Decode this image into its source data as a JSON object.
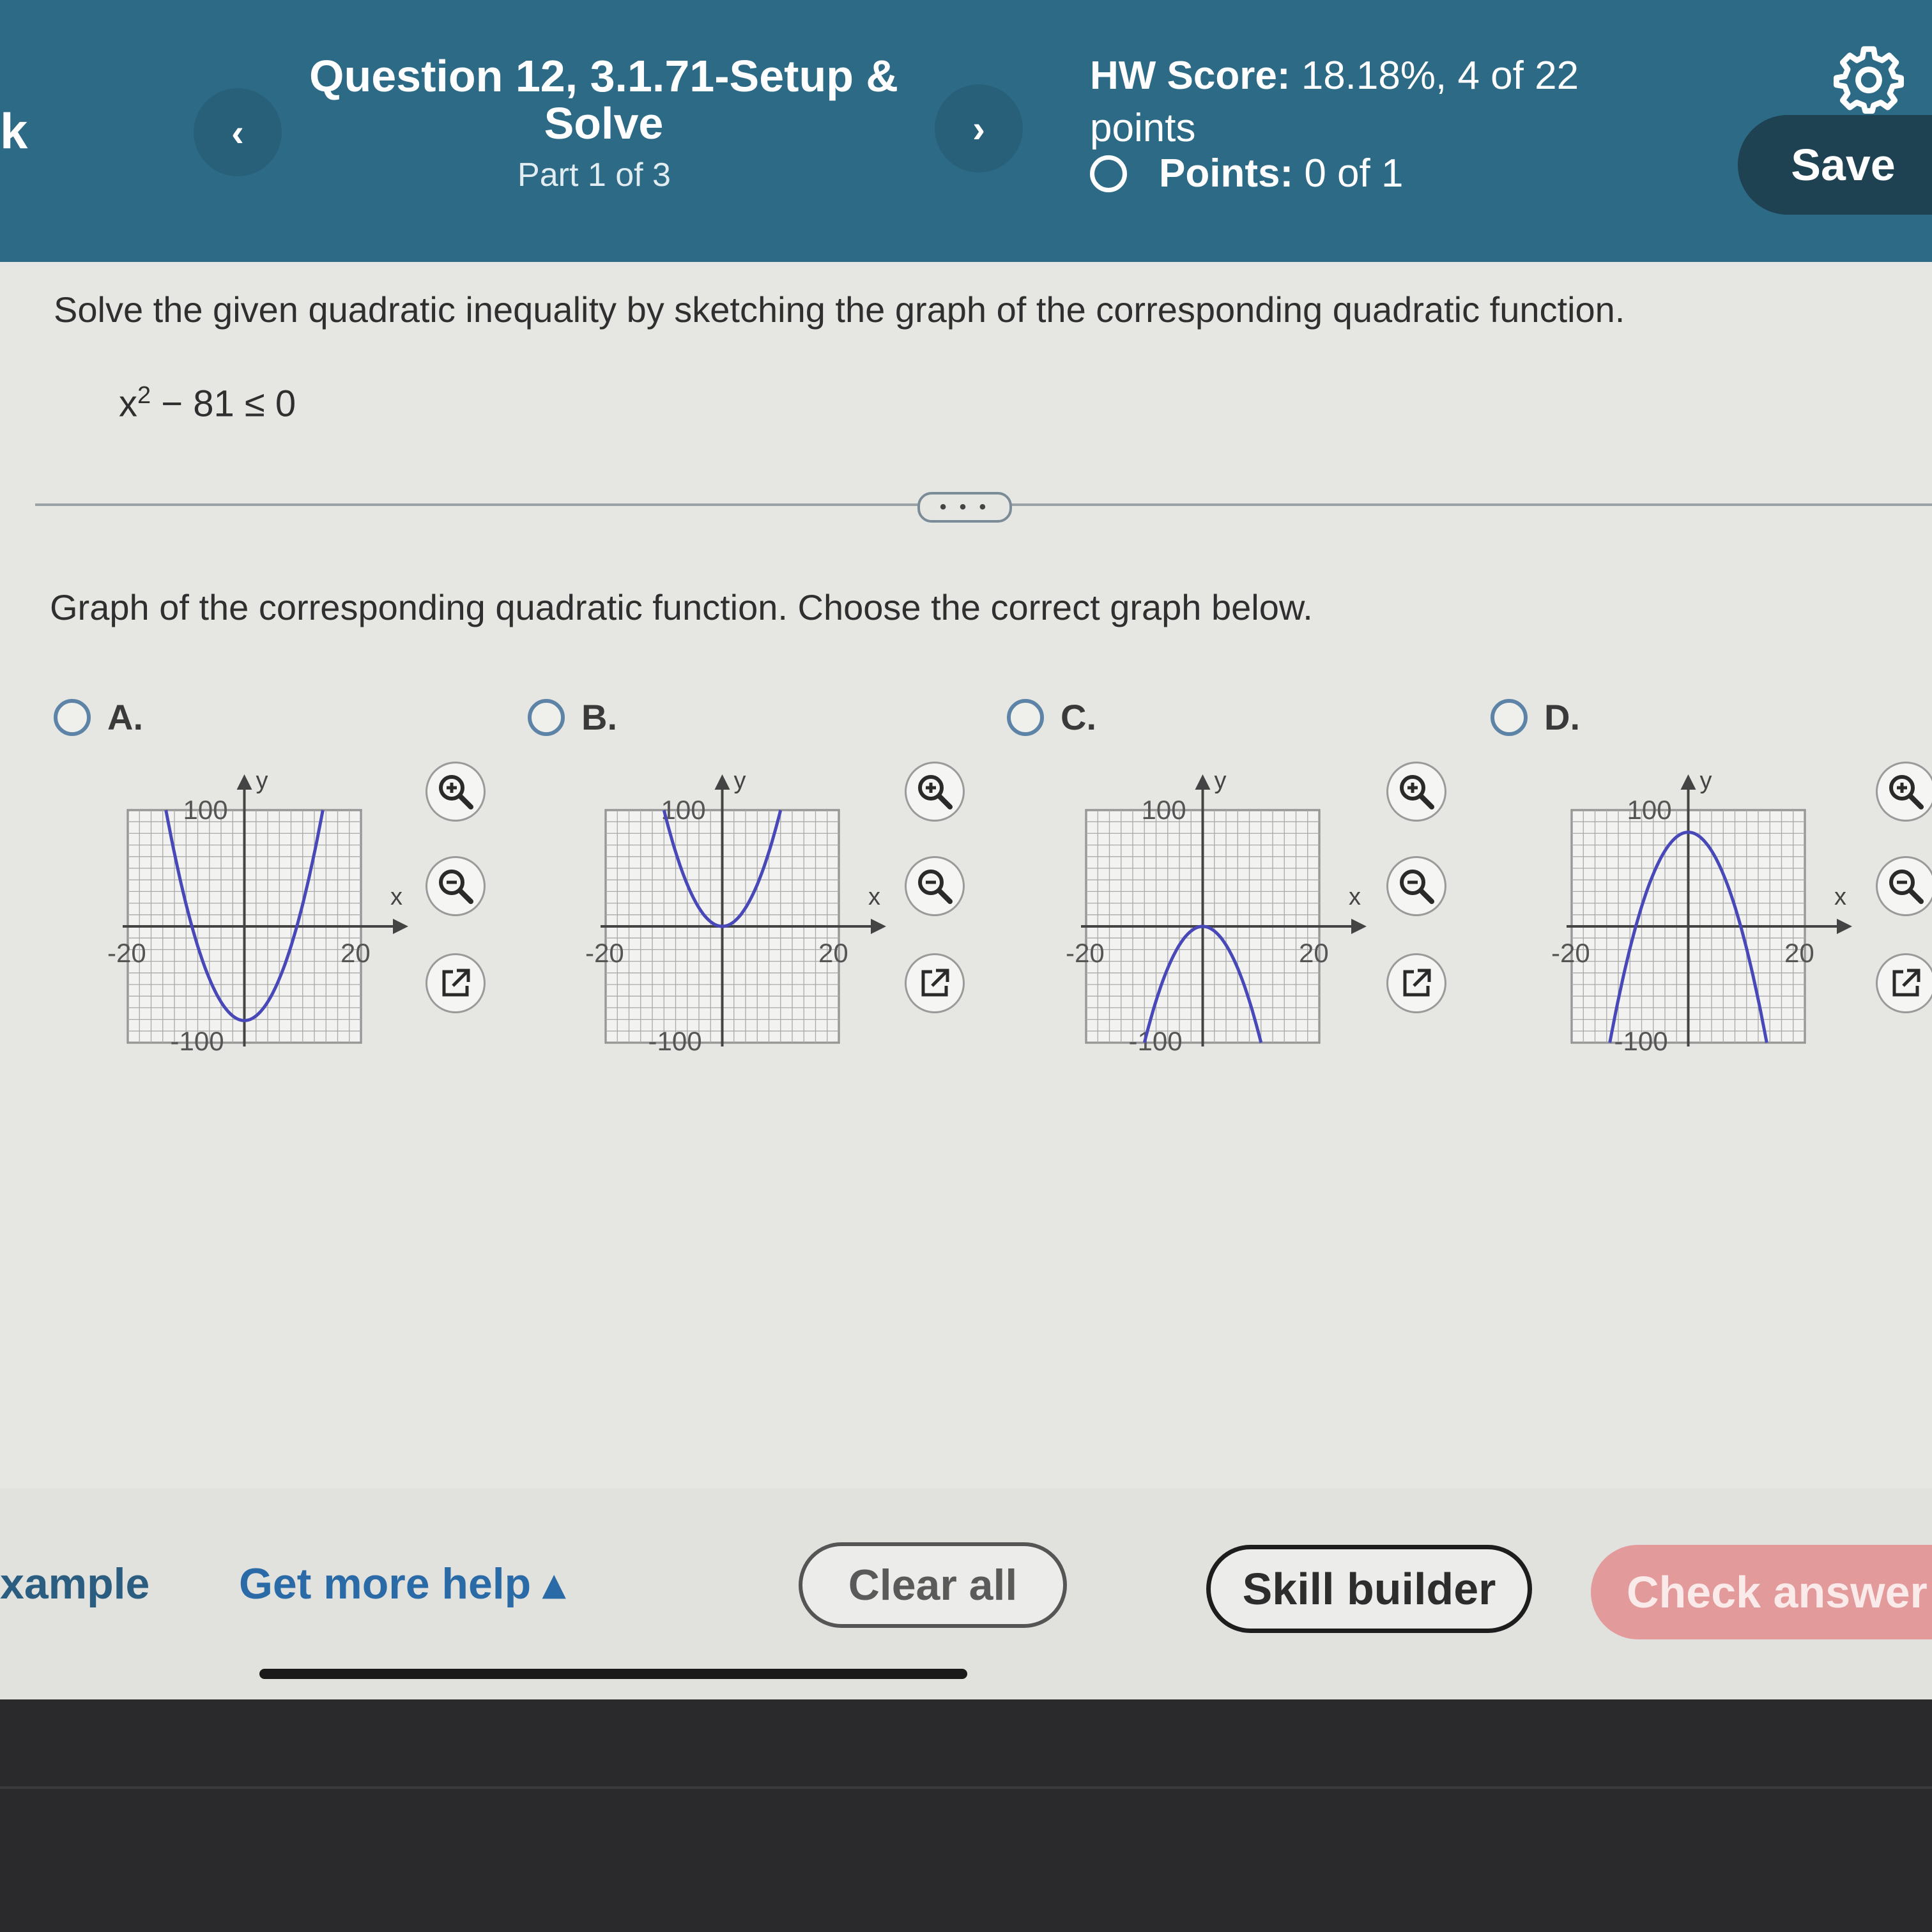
{
  "header": {
    "left_edge_text": "k",
    "question_title": "Question 12, 3.1.71-Setup & Solve",
    "part": "Part 1 of 3",
    "hw_score_label": "HW Score:",
    "hw_score_value": "18.18%, 4 of 22 points",
    "points_label": "Points:",
    "points_value": "0 of 1",
    "prev_icon": "‹",
    "next_icon": "›",
    "save_label": "Save"
  },
  "question": {
    "instruction": "Solve the given quadratic inequality by sketching the graph of the corresponding quadratic function.",
    "inequality_base": "x",
    "inequality_exp": "2",
    "inequality_rest": " − 81 ≤ 0",
    "expand_label": "• • •",
    "prompt": "Graph of the corresponding quadratic function. Choose the correct graph below."
  },
  "options": [
    {
      "label": "A.",
      "shape": "up",
      "vertex": [
        0,
        -81
      ]
    },
    {
      "label": "B.",
      "shape": "up",
      "vertex": [
        0,
        0
      ]
    },
    {
      "label": "C.",
      "shape": "down",
      "vertex": [
        0,
        0
      ]
    },
    {
      "label": "D.",
      "shape": "down",
      "vertex": [
        0,
        81
      ]
    }
  ],
  "graph_axes": {
    "x_min_label": "-20",
    "x_max_label": "20",
    "y_max_label": "100",
    "y_min_label": "-100",
    "x_axis_label": "x",
    "y_axis_label": "y",
    "xlim": [
      -20,
      20
    ],
    "ylim": [
      -100,
      100
    ]
  },
  "footer": {
    "example_label": "xample",
    "get_more_help": "Get more help ▴",
    "clear_all": "Clear all",
    "skill_builder": "Skill builder",
    "check_answer": "Check answer"
  },
  "colors": {
    "header_bg": "#2d6a86",
    "curve": "#4848b8",
    "check_button": "#e39a9a"
  }
}
